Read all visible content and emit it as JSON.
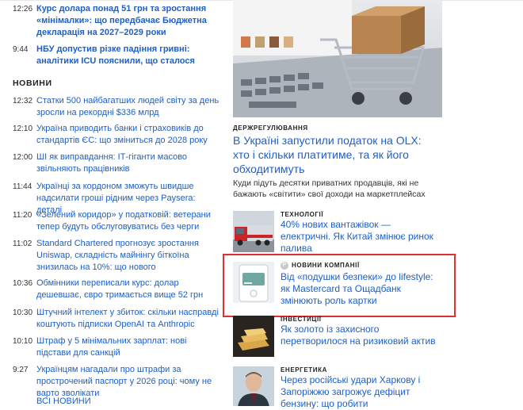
{
  "top_news": [
    {
      "time": "12:26",
      "title": "Курс долара понад 51 грн та зростання «мінімалки»: що передбачає Бюджетна декларація на 2027–2029 роки",
      "bold": true
    },
    {
      "time": "9:44",
      "title": "НБУ допустив різке падіння гривні: аналітики ICU пояснили, що сталося",
      "bold": true
    }
  ],
  "news_section": {
    "heading": "НОВИНИ",
    "items": [
      {
        "time": "12:32",
        "title": "Статки 500 найбагатших людей світу за день зросли на рекордні $336 млрд"
      },
      {
        "time": "12:10",
        "title": "Україна приводить банки і страховиків до стандартів ЄС: що зміниться до 2028 року"
      },
      {
        "time": "12:00",
        "title": "ШІ як виправдання: ІТ-гіганти масово звільняють працівників"
      },
      {
        "time": "11:44",
        "title": "Українці за кордоном зможуть швидше надсилати гроші рідним через Paysera: деталі"
      },
      {
        "time": "11:20",
        "title": "«Зелений коридор» у податковій: ветерани тепер будуть обслуговуватись без черги"
      },
      {
        "time": "11:02",
        "title": "Standard Chartered прогнозує зростання Uniswap, складність майнінгу біткоїна знизилась на 10%: що нового"
      },
      {
        "time": "10:36",
        "title": "Обмінники переписали курс: долар дешевшає, євро тримається вище 52 грн"
      },
      {
        "time": "10:30",
        "title": "Штучний інтелект у збиток: скільки насправді коштують підписки OpenAI та Anthropic"
      },
      {
        "time": "10:10",
        "title": "Штраф у 5 мінімальних зарплат: нові підстави для санкцій"
      },
      {
        "time": "9:27",
        "title": "Українцям нагадали про штрафи за прострочений паспорт у 2026 році: чому не варто зволікати"
      }
    ],
    "all_news_label": "ВСІ НОВИНИ"
  },
  "hero": {
    "category": "ДЕРЖРЕГУЛЮВАННЯ",
    "title": "В Україні запустили податок на OLX: хто і скільки платитиме, та як його обходитимуть",
    "description": "Куди підуть десятки приватних продавців, які не бажають «світити» свої доходи на маркетплейсах",
    "image_icon": "shopping-cart-laptop-image"
  },
  "cards": [
    {
      "category": "ТЕХНОЛОГІЇ",
      "title": "40% нових вантажівок — електричні. Як Китай змінює ринок палива",
      "partner": false,
      "image_icon": "red-truck-image"
    },
    {
      "category": "НОВИНИ КОМПАНІЇ",
      "title": "Від «подушки безпеки» до lifestyle: як Mastercard та Ощадбанк змінюють роль картки",
      "partner": true,
      "badge": "P",
      "image_icon": "phone-card-image"
    },
    {
      "category": "ІНВЕСТИЦІЇ",
      "title": "Як золото із захисного перетворилося на ризиковий актив",
      "partner": false,
      "image_icon": "gold-bars-image"
    },
    {
      "category": "ЕНЕРГЕТИКА",
      "title": "Через російські удари Харкову і Запоріжжю загрожує дефіцит бензину: що робити",
      "partner": false,
      "image_icon": "portrait-image"
    }
  ],
  "colors": {
    "link": "#1d5fc7",
    "highlight": "#e03030"
  }
}
